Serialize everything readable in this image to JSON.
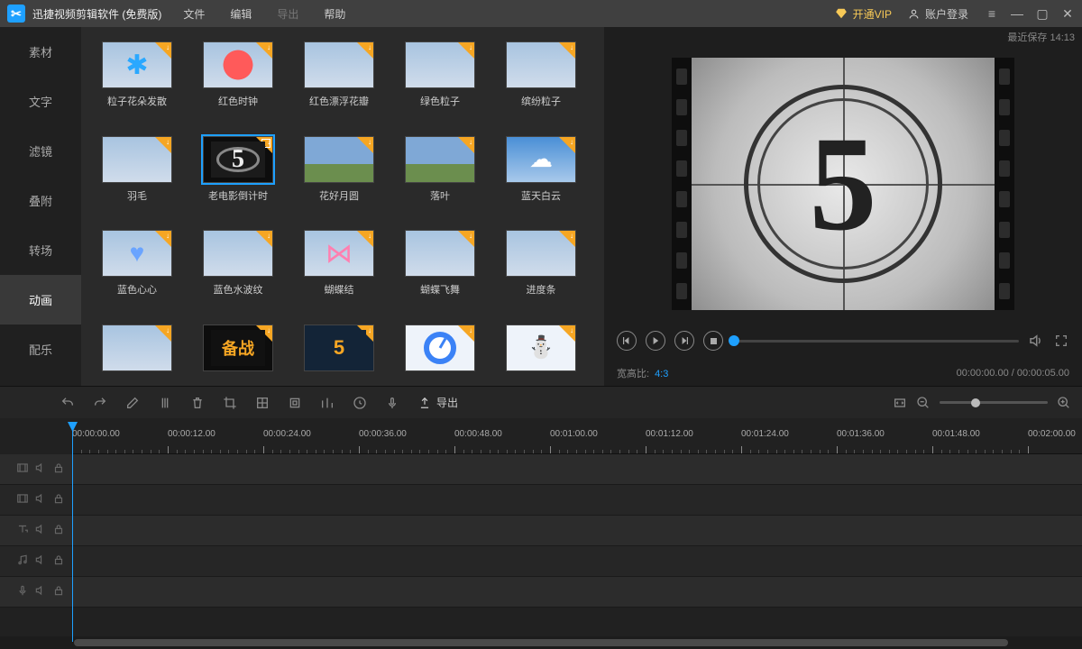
{
  "titlebar": {
    "app_title": "迅捷视频剪辑软件 (免费版)",
    "menu": {
      "file": "文件",
      "edit": "编辑",
      "export": "导出",
      "help": "帮助"
    },
    "vip": "开通VIP",
    "login": "账户登录",
    "recent_save": "最近保存 14:13"
  },
  "sidebar": {
    "items": [
      "素材",
      "文字",
      "滤镜",
      "叠附",
      "转场",
      "动画",
      "配乐"
    ],
    "active_index": 5
  },
  "assets": [
    {
      "label": "粒子花朵发散",
      "bg": "light",
      "art": "flower"
    },
    {
      "label": "红色时钟",
      "bg": "light",
      "art": "clock"
    },
    {
      "label": "红色漂浮花瓣",
      "bg": "light",
      "art": ""
    },
    {
      "label": "绿色粒子",
      "bg": "light",
      "art": ""
    },
    {
      "label": "缤纷粒子",
      "bg": "light",
      "art": ""
    },
    {
      "label": "羽毛",
      "bg": "light",
      "art": ""
    },
    {
      "label": "老电影倒计时",
      "bg": "blackbg",
      "art": "num5",
      "selected": true
    },
    {
      "label": "花好月圆",
      "bg": "grass",
      "art": ""
    },
    {
      "label": "落叶",
      "bg": "grass",
      "art": ""
    },
    {
      "label": "蓝天白云",
      "bg": "sky",
      "art": "cloud"
    },
    {
      "label": "蓝色心心",
      "bg": "light",
      "art": "heart"
    },
    {
      "label": "蓝色水波纹",
      "bg": "light",
      "art": ""
    },
    {
      "label": "蝴蝶结",
      "bg": "light",
      "art": "bow"
    },
    {
      "label": "蝴蝶飞舞",
      "bg": "light",
      "art": ""
    },
    {
      "label": "进度条",
      "bg": "light",
      "art": ""
    },
    {
      "label": "",
      "bg": "light",
      "art": ""
    },
    {
      "label": "",
      "bg": "blackbg",
      "art": "dark",
      "text": "备战"
    },
    {
      "label": "",
      "bg": "dblue",
      "art": "darkblue",
      "text": "5"
    },
    {
      "label": "",
      "bg": "white",
      "art": "whitec"
    },
    {
      "label": "",
      "bg": "white",
      "art": "snow"
    }
  ],
  "preview": {
    "countdown_number": "5",
    "aspect_label": "宽高比:",
    "aspect_value": "4:3",
    "time_current": "00:00:00.00",
    "time_total": "00:00:05.00",
    "time_separator": " / "
  },
  "toolbar": {
    "export_label": "导出"
  },
  "timeline": {
    "ticks": [
      "00:00:00.00",
      "00:00:12.00",
      "00:00:24.00",
      "00:00:36.00",
      "00:00:48.00",
      "00:01:00.00",
      "00:01:12.00",
      "00:01:24.00",
      "00:01:36.00",
      "00:01:48.00",
      "00:02:00.00"
    ],
    "tracks": [
      "video1",
      "video2",
      "text",
      "audio",
      "voice"
    ]
  }
}
